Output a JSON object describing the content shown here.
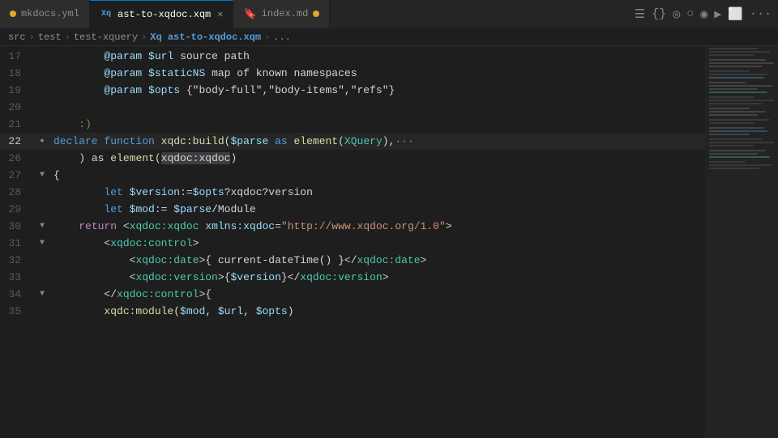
{
  "tabs": [
    {
      "id": "mkdocs",
      "label": "mkdocs.yml",
      "modified": true,
      "active": false,
      "icon": "none",
      "icon_color": ""
    },
    {
      "id": "ast",
      "label": "ast-to-xqdoc.xqm",
      "modified": false,
      "active": true,
      "icon": "xq",
      "close": true
    },
    {
      "id": "index",
      "label": "index.md",
      "modified": true,
      "active": false,
      "icon": "md",
      "icon_color": "#519aba"
    }
  ],
  "toolbar": {
    "icons": [
      "≡",
      "{}",
      "◎",
      "○",
      "◉",
      "▶",
      "⬜",
      "···"
    ]
  },
  "breadcrumb": {
    "parts": [
      "src",
      "test",
      "test-xquery",
      "ast-to-xqdoc.xqm",
      "..."
    ],
    "highlight_index": 3
  },
  "lines": [
    {
      "num": 17,
      "indent": 2,
      "tokens": [
        {
          "t": "@param",
          "c": "param"
        },
        {
          "t": " ",
          "c": "plain"
        },
        {
          "t": "$url",
          "c": "param"
        },
        {
          "t": " source path",
          "c": "plain"
        }
      ]
    },
    {
      "num": 18,
      "indent": 2,
      "tokens": [
        {
          "t": "@param",
          "c": "param"
        },
        {
          "t": " ",
          "c": "plain"
        },
        {
          "t": "$staticNS",
          "c": "param"
        },
        {
          "t": " map ",
          "c": "plain"
        },
        {
          "t": "of",
          "c": "plain"
        },
        {
          "t": " known namespaces",
          "c": "plain"
        }
      ]
    },
    {
      "num": 19,
      "indent": 2,
      "tokens": [
        {
          "t": "@param",
          "c": "param"
        },
        {
          "t": " ",
          "c": "plain"
        },
        {
          "t": "$opts",
          "c": "param"
        },
        {
          "t": " {\"body-full\",\"body-items\",\"refs\"}",
          "c": "plain"
        }
      ]
    },
    {
      "num": 20,
      "indent": 0,
      "tokens": []
    },
    {
      "num": 21,
      "indent": 2,
      "tokens": [
        {
          "t": ":)",
          "c": "comment"
        }
      ]
    },
    {
      "num": 22,
      "indent": 0,
      "active": true,
      "tokens": [
        {
          "t": "declare ",
          "c": "kw"
        },
        {
          "t": "function ",
          "c": "kw"
        },
        {
          "t": "xqdc:build",
          "c": "fn"
        },
        {
          "t": "(",
          "c": "punct"
        },
        {
          "t": "$parse",
          "c": "param"
        },
        {
          "t": " as ",
          "c": "kw"
        },
        {
          "t": "element",
          "c": "fn"
        },
        {
          "t": "(",
          "c": "punct"
        },
        {
          "t": "XQuery",
          "c": "type"
        },
        {
          "t": ")",
          "c": "punct"
        },
        {
          "t": ",",
          "c": "punct"
        },
        {
          "t": "···",
          "c": "ellipsis"
        }
      ]
    },
    {
      "num": 26,
      "indent": 2,
      "tokens": [
        {
          "t": ") as ",
          "c": "plain"
        },
        {
          "t": "element",
          "c": "fn"
        },
        {
          "t": "(",
          "c": "punct"
        },
        {
          "t": "xqdoc:xqdoc",
          "c": "var-highlight"
        },
        {
          "t": ")",
          "c": "punct"
        }
      ]
    },
    {
      "num": 27,
      "indent": 0,
      "collapse": true,
      "tokens": [
        {
          "t": "{",
          "c": "punct"
        }
      ]
    },
    {
      "num": 28,
      "indent": 3,
      "tokens": [
        {
          "t": "let ",
          "c": "kw"
        },
        {
          "t": "$version",
          "c": "param"
        },
        {
          "t": ":=",
          "c": "op"
        },
        {
          "t": "$opts",
          "c": "param"
        },
        {
          "t": "?xqdoc?version",
          "c": "plain"
        }
      ]
    },
    {
      "num": 29,
      "indent": 3,
      "tokens": [
        {
          "t": "let ",
          "c": "kw"
        },
        {
          "t": "$mod",
          "c": "param"
        },
        {
          "t": ":= ",
          "c": "op"
        },
        {
          "t": "$parse",
          "c": "param"
        },
        {
          "t": "/Module",
          "c": "plain"
        }
      ]
    },
    {
      "num": 30,
      "indent": 2,
      "collapse": true,
      "tokens": [
        {
          "t": "return ",
          "c": "kw2"
        },
        {
          "t": "<",
          "c": "punct"
        },
        {
          "t": "xqdoc:xqdoc",
          "c": "tag"
        },
        {
          "t": " ",
          "c": "plain"
        },
        {
          "t": "xmlns:xqdoc",
          "c": "attr"
        },
        {
          "t": "=",
          "c": "op"
        },
        {
          "t": "\"http://www.xqdoc.org/1.0\"",
          "c": "str"
        },
        {
          "t": ">",
          "c": "punct"
        }
      ]
    },
    {
      "num": 31,
      "indent": 3,
      "collapse": true,
      "tokens": [
        {
          "t": "<",
          "c": "punct"
        },
        {
          "t": "xqdoc:control",
          "c": "tag"
        },
        {
          "t": ">",
          "c": "punct"
        }
      ]
    },
    {
      "num": 32,
      "indent": 5,
      "tokens": [
        {
          "t": "<",
          "c": "punct"
        },
        {
          "t": "xqdoc:date",
          "c": "tag"
        },
        {
          "t": ">{ current-dateTime() }</",
          "c": "plain"
        },
        {
          "t": "xqdoc:date",
          "c": "tag"
        },
        {
          "t": ">",
          "c": "punct"
        }
      ]
    },
    {
      "num": 33,
      "indent": 5,
      "tokens": [
        {
          "t": "<",
          "c": "punct"
        },
        {
          "t": "xqdoc:version",
          "c": "tag"
        },
        {
          "t": ">{",
          "c": "punct"
        },
        {
          "t": "$version",
          "c": "param"
        },
        {
          "t": "}</",
          "c": "punct"
        },
        {
          "t": "xqdoc:version",
          "c": "tag"
        },
        {
          "t": ">",
          "c": "punct"
        }
      ]
    },
    {
      "num": 34,
      "indent": 3,
      "collapse": true,
      "tokens": [
        {
          "t": "</",
          "c": "punct"
        },
        {
          "t": "xqdoc:control",
          "c": "tag"
        },
        {
          "t": ">{",
          "c": "punct"
        }
      ]
    },
    {
      "num": 35,
      "indent": 3,
      "tokens": [
        {
          "t": "xqdc:module(",
          "c": "fn"
        },
        {
          "t": "$mod",
          "c": "param"
        },
        {
          "t": ", ",
          "c": "plain"
        },
        {
          "t": "$url",
          "c": "param"
        },
        {
          "t": ", ",
          "c": "plain"
        },
        {
          "t": "$opts",
          "c": "param"
        },
        {
          "t": ")",
          "c": "punct"
        }
      ]
    }
  ]
}
